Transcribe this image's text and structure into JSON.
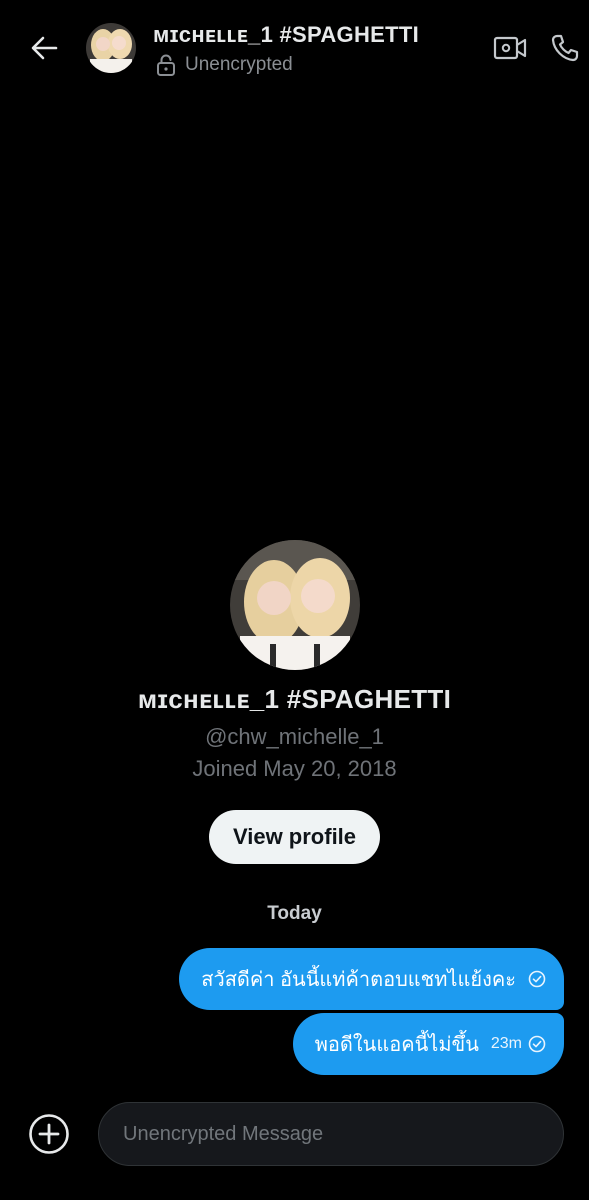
{
  "header": {
    "title": "ᴍɪᴄʜᴇʟʟᴇ_1 #SPAGHETTI",
    "encryption_status": "Unencrypted"
  },
  "profile": {
    "name": "ᴍɪᴄʜᴇʟʟᴇ_1 #SPAGHETTI",
    "handle": "@chw_michelle_1",
    "joined": "Joined May 20, 2018",
    "view_profile_label": "View profile"
  },
  "conversation": {
    "day_separator": "Today",
    "messages": [
      {
        "text": "สวัสดีค่า อันนี้แท่ค้าตอบแชทไแย้งคะ",
        "time": "",
        "status_icon": "check-circle-icon"
      },
      {
        "text": "พอดีในแอคนี้ไม่ขึ้น",
        "time": "23m",
        "status_icon": "check-circle-icon"
      }
    ]
  },
  "composer": {
    "placeholder": "Unencrypted Message"
  },
  "icons": {
    "back": "arrow-left-icon",
    "lock": "unlocked-padlock-icon",
    "video": "video-camera-icon",
    "call": "phone-icon",
    "add": "plus-circle-icon"
  },
  "colors": {
    "background": "#000000",
    "bubble": "#1d9bf0",
    "button": "#eff3f4",
    "muted_text": "#6f7378"
  }
}
